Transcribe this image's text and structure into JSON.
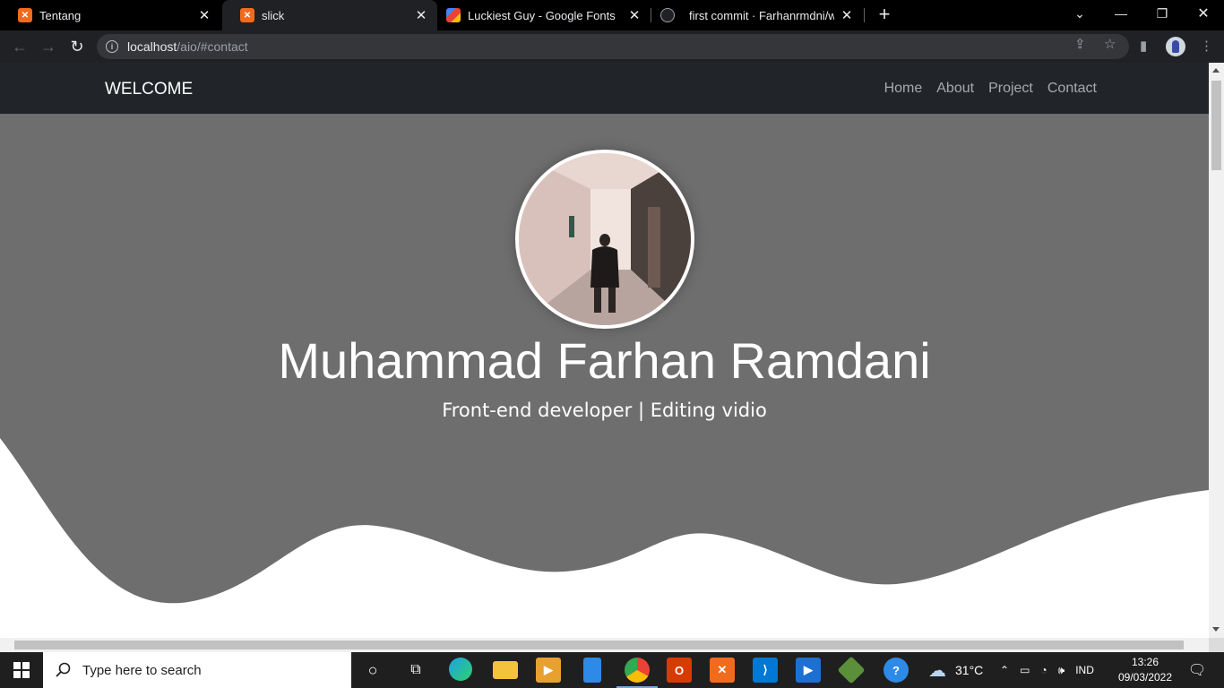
{
  "browser": {
    "tabs": [
      {
        "title": "Tentang",
        "favicon": "xampp-icon",
        "active": false
      },
      {
        "title": "slick",
        "favicon": "xampp-icon",
        "active": true
      },
      {
        "title": "Luckiest Guy - Google Fonts",
        "favicon": "google-fonts-icon",
        "active": false
      },
      {
        "title": "first commit · Farhanrmdni/webre",
        "favicon": "github-icon",
        "active": false
      }
    ],
    "url_host": "localhost",
    "url_path": "/aio/#contact"
  },
  "page": {
    "brand": "WELCOME",
    "nav": [
      "Home",
      "About",
      "Project",
      "Contact"
    ],
    "hero_name": "Muhammad Farhan Ramdani",
    "hero_subtitle": "Front-end developer | Editing vidio",
    "hero_bg_color": "#6e6e6e",
    "navbar_color": "#212529"
  },
  "taskbar": {
    "search_placeholder": "Type here to search",
    "weather": "31°C",
    "language": "IND",
    "time": "13:26",
    "date": "09/03/2022"
  }
}
